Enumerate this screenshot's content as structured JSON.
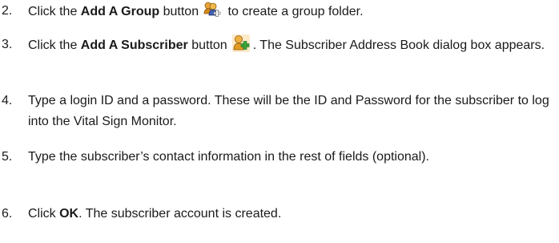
{
  "steps": [
    {
      "number": "2.",
      "prefix": "Click the ",
      "bold": "Add A Group",
      "middle": " button",
      "icon": "add-group-icon",
      "suffix": " to create a group folder."
    },
    {
      "number": "3.",
      "prefix": "Click the ",
      "bold": "Add A Subscriber",
      "middle": " button",
      "icon": "add-subscriber-icon",
      "suffix": ". The Subscriber Address Book dialog box appears."
    },
    {
      "number": "4.",
      "text": "Type a login ID and a password. These will be the ID and Password for the subscriber to log into the Vital Sign Monitor."
    },
    {
      "number": "5.",
      "text": "Type the subscriber’s contact information in the rest of fields (optional)."
    },
    {
      "number": "6.",
      "prefix": "Click ",
      "bold": "OK",
      "suffix": ". The subscriber account is created."
    }
  ]
}
